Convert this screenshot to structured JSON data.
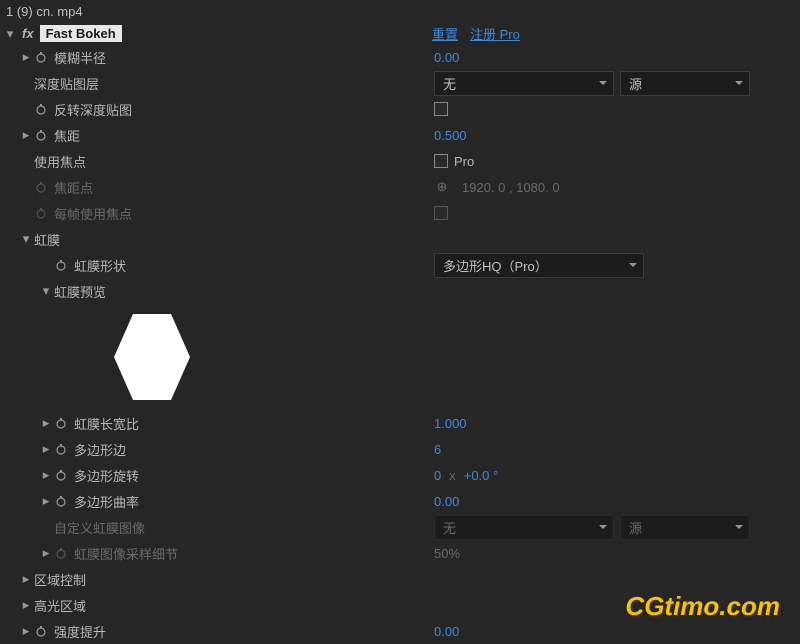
{
  "title": "1 (9) cn. mp4",
  "effect": {
    "name": "Fast Bokeh",
    "reset": "重置",
    "register": "注册 Pro"
  },
  "params": {
    "blur_radius": {
      "label": "模糊半径",
      "value": "0.00"
    },
    "depth_layer": {
      "label": "深度贴图层",
      "value": "无",
      "source": "源"
    },
    "invert_depth": {
      "label": "反转深度贴图"
    },
    "focal_length": {
      "label": "焦距",
      "value": "0.500"
    },
    "use_focus": {
      "label": "使用焦点",
      "checked_label": "Pro"
    },
    "focus_point": {
      "label": "焦距点",
      "value": "1920. 0 , 1080. 0"
    },
    "per_frame_focus": {
      "label": "每帧使用焦点"
    },
    "iris": {
      "label": "虹膜",
      "shape": {
        "label": "虹膜形状",
        "value": "多边形HQ（Pro）"
      },
      "preview": {
        "label": "虹膜预览"
      },
      "aspect": {
        "label": "虹膜长宽比",
        "value": "1.000"
      },
      "sides": {
        "label": "多边形边",
        "value": "6"
      },
      "rotation": {
        "label": "多边形旋转",
        "value_a": "0",
        "value_b": "+0.0 °"
      },
      "curvature": {
        "label": "多边形曲率",
        "value": "0.00"
      },
      "custom_image": {
        "label": "自定义虹膜图像",
        "value": "无",
        "source": "源"
      },
      "sampling": {
        "label": "虹膜图像采样细节",
        "value": "50%"
      }
    },
    "region_control": {
      "label": "区域控制"
    },
    "highlight_region": {
      "label": "高光区域"
    },
    "intensity_boost": {
      "label": "强度提升",
      "value": "0.00"
    }
  },
  "watermark": "CGtimo.com",
  "rotation_x": "x"
}
